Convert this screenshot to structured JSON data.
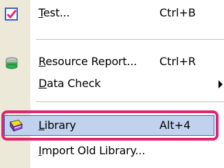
{
  "menu": {
    "items": [
      {
        "label_prefix": "",
        "label_underline": "T",
        "label_rest": "est...",
        "shortcut": "Ctrl+B",
        "icon": "check-icon"
      },
      {
        "label_prefix": "",
        "label_underline": "R",
        "label_rest": "esource Report...",
        "shortcut": "Ctrl+R",
        "icon": "database-icon"
      },
      {
        "label_prefix": "",
        "label_underline": "D",
        "label_rest": "ata Check",
        "shortcut": "",
        "icon": "submenu-arrow-icon"
      },
      {
        "label_prefix": "",
        "label_underline": "L",
        "label_rest": "ibrary",
        "shortcut": "Alt+4",
        "icon": "library-book-icon"
      },
      {
        "label_prefix": "",
        "label_underline": "I",
        "label_rest": "mport Old Library...",
        "shortcut": "",
        "icon": ""
      }
    ],
    "colors": {
      "gutter": "#ece9d8",
      "active_background": "#c1d2ee",
      "highlight_border": "#e0256f"
    }
  }
}
